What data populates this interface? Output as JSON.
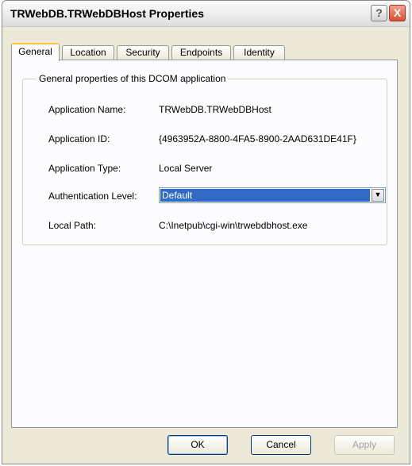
{
  "window": {
    "title": "TRWebDB.TRWebDBHost Properties",
    "help_glyph": "?",
    "close_glyph": "X"
  },
  "tabs": [
    {
      "label": "General",
      "active": true
    },
    {
      "label": "Location",
      "active": false
    },
    {
      "label": "Security",
      "active": false
    },
    {
      "label": "Endpoints",
      "active": false
    },
    {
      "label": "Identity",
      "active": false
    }
  ],
  "general": {
    "group_title": "General properties of this DCOM application",
    "app_name_label": "Application Name:",
    "app_name": "TRWebDB.TRWebDBHost",
    "app_id_label": "Application ID:",
    "app_id": "{4963952A-8800-4FA5-8900-2AAD631DE41F}",
    "app_type_label": "Application Type:",
    "app_type": "Local Server",
    "auth_label": "Authentication Level:",
    "auth_value": "Default",
    "local_path_label": "Local Path:",
    "local_path": "C:\\Inetpub\\cgi-win\\trwebdbhost.exe"
  },
  "buttons": {
    "ok": "OK",
    "cancel": "Cancel",
    "apply": "Apply"
  },
  "colors": {
    "accent": "#316ac5",
    "tab_highlight": "#ffc83c",
    "close": "#d84f33"
  }
}
